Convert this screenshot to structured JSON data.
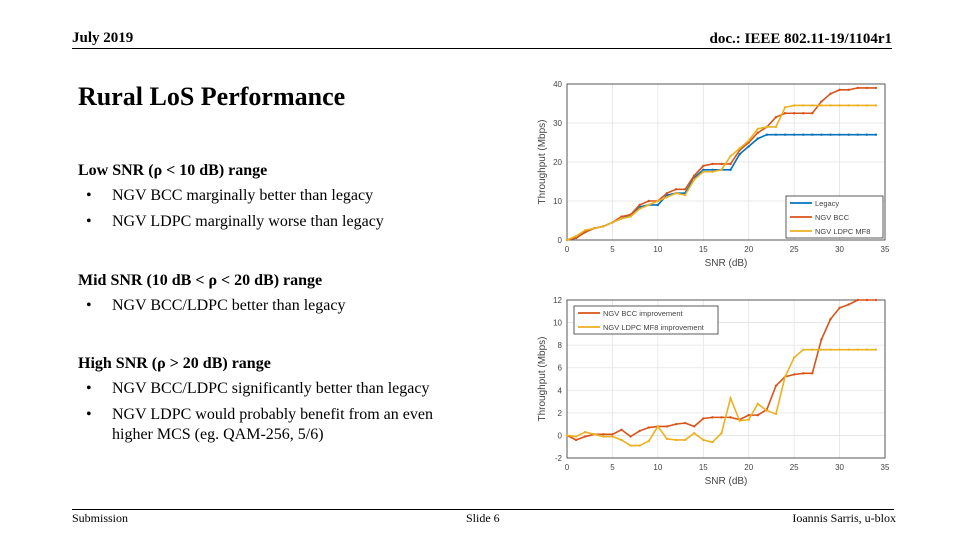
{
  "header": {
    "date": "July 2019",
    "doc": "doc.: IEEE 802.11-19/1104r1"
  },
  "title": "Rural LoS Performance",
  "sections": [
    {
      "heading": "Low SNR (ρ < 10 dB) range",
      "bullets": [
        "NGV BCC marginally better than legacy",
        "NGV LDPC marginally worse than legacy"
      ]
    },
    {
      "heading": "Mid SNR (10 dB < ρ < 20 dB) range",
      "bullets": [
        "NGV BCC/LDPC better than legacy"
      ]
    },
    {
      "heading": "High SNR (ρ > 20 dB) range",
      "bullets": [
        "NGV BCC/LDPC significantly better than legacy",
        "NGV LDPC would probably benefit from an even higher MCS (eg. QAM-256, 5/6)"
      ]
    }
  ],
  "bullet_glyph": "•",
  "footer": {
    "left": "Submission",
    "center": "Slide 6",
    "right": "Ioannis Sarris, u-blox"
  },
  "chart_data": [
    {
      "type": "line",
      "title": "",
      "xlabel": "SNR (dB)",
      "ylabel": "Throughput (Mbps)",
      "xlim": [
        0,
        35
      ],
      "ylim": [
        0,
        40
      ],
      "xticks": [
        0,
        5,
        10,
        15,
        20,
        25,
        30,
        35
      ],
      "yticks": [
        0,
        10,
        20,
        30,
        40
      ],
      "grid": true,
      "legend_position": "bottom-right",
      "x": [
        0,
        1,
        2,
        3,
        4,
        5,
        6,
        7,
        8,
        9,
        10,
        11,
        12,
        13,
        14,
        15,
        16,
        17,
        18,
        19,
        20,
        21,
        22,
        23,
        24,
        25,
        26,
        27,
        28,
        29,
        30,
        31,
        32,
        33,
        34
      ],
      "series": [
        {
          "name": "Legacy",
          "color": "#0072bd",
          "values": [
            0,
            0.5,
            2,
            3,
            3.5,
            4.5,
            5.5,
            6.5,
            8.5,
            9,
            9,
            11.5,
            12,
            12,
            16,
            18,
            18,
            18,
            18,
            22,
            24,
            26,
            27,
            27,
            27,
            27,
            27,
            27,
            27,
            27,
            27,
            27,
            27,
            27,
            27
          ]
        },
        {
          "name": "NGV BCC",
          "color": "#d95319",
          "values": [
            0,
            0.5,
            2,
            3,
            3.5,
            4.5,
            6,
            6.5,
            9,
            10,
            10,
            12,
            13,
            13,
            16.5,
            19,
            19.5,
            19.5,
            19.5,
            23,
            25,
            27.5,
            29,
            31.5,
            32.5,
            32.5,
            32.5,
            32.5,
            35.5,
            37.5,
            38.5,
            38.5,
            39,
            39,
            39
          ]
        },
        {
          "name": "NGV LDPC MF8",
          "color": "#edb120",
          "values": [
            0,
            1,
            2.5,
            3,
            3.5,
            4.5,
            5.5,
            6,
            8,
            9,
            10,
            11,
            12,
            11.5,
            15.5,
            17.5,
            17.5,
            18,
            21.5,
            23.5,
            25.5,
            28.5,
            29,
            29,
            34,
            34.5,
            34.5,
            34.5,
            34.5,
            34.5,
            34.5,
            34.5,
            34.5,
            34.5,
            34.5
          ]
        }
      ]
    },
    {
      "type": "line",
      "title": "",
      "xlabel": "SNR (dB)",
      "ylabel": "Throughput (Mbps)",
      "xlim": [
        0,
        35
      ],
      "ylim": [
        -2,
        12
      ],
      "xticks": [
        0,
        5,
        10,
        15,
        20,
        25,
        30,
        35
      ],
      "yticks": [
        -2,
        0,
        2,
        4,
        6,
        8,
        10,
        12
      ],
      "grid": true,
      "legend_position": "top-left",
      "x": [
        0,
        1,
        2,
        3,
        4,
        5,
        6,
        7,
        8,
        9,
        10,
        11,
        12,
        13,
        14,
        15,
        16,
        17,
        18,
        19,
        20,
        21,
        22,
        23,
        24,
        25,
        26,
        27,
        28,
        29,
        30,
        31,
        32,
        33,
        34
      ],
      "series": [
        {
          "name": "NGV BCC improvement",
          "color": "#d95319",
          "values": [
            0,
            -0.4,
            -0.1,
            0.1,
            0.1,
            0.1,
            0.5,
            -0.1,
            0.4,
            0.7,
            0.8,
            0.8,
            1,
            1.1,
            0.8,
            1.5,
            1.6,
            1.6,
            1.6,
            1.4,
            1.8,
            1.8,
            2.3,
            4.4,
            5.2,
            5.4,
            5.5,
            5.5,
            8.5,
            10.3,
            11.3,
            11.6,
            12,
            12,
            12
          ]
        },
        {
          "name": "NGV LDPC MF8 improvement",
          "color": "#edb120",
          "values": [
            0,
            -0.1,
            0.3,
            0.1,
            -0.1,
            -0.1,
            -0.4,
            -0.9,
            -0.9,
            -0.5,
            0.8,
            -0.3,
            -0.4,
            -0.4,
            0.2,
            -0.4,
            -0.6,
            0.2,
            3.3,
            1.3,
            1.4,
            2.8,
            2.2,
            1.9,
            5.2,
            6.9,
            7.6,
            7.6,
            7.6,
            7.6,
            7.6,
            7.6,
            7.6,
            7.6,
            7.6
          ]
        }
      ]
    }
  ]
}
